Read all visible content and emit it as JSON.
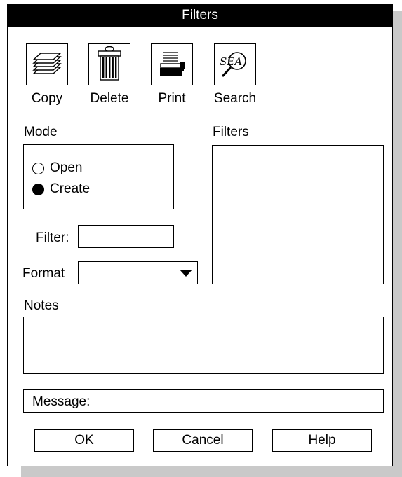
{
  "window": {
    "title": "Filters"
  },
  "toolbar": {
    "items": [
      {
        "label": "Copy",
        "icon": "copy-icon"
      },
      {
        "label": "Delete",
        "icon": "trash-icon"
      },
      {
        "label": "Print",
        "icon": "printer-icon"
      },
      {
        "label": "Search",
        "icon": "search-icon"
      }
    ]
  },
  "mode": {
    "label": "Mode",
    "options": [
      {
        "label": "Open",
        "selected": false
      },
      {
        "label": "Create",
        "selected": true
      }
    ]
  },
  "filter": {
    "label": "Filter:",
    "value": ""
  },
  "format": {
    "label": "Format",
    "value": ""
  },
  "filters_list": {
    "label": "Filters",
    "items": []
  },
  "notes": {
    "label": "Notes",
    "value": ""
  },
  "message": {
    "label": "Message:"
  },
  "buttons": {
    "ok": "OK",
    "cancel": "Cancel",
    "help": "Help"
  }
}
